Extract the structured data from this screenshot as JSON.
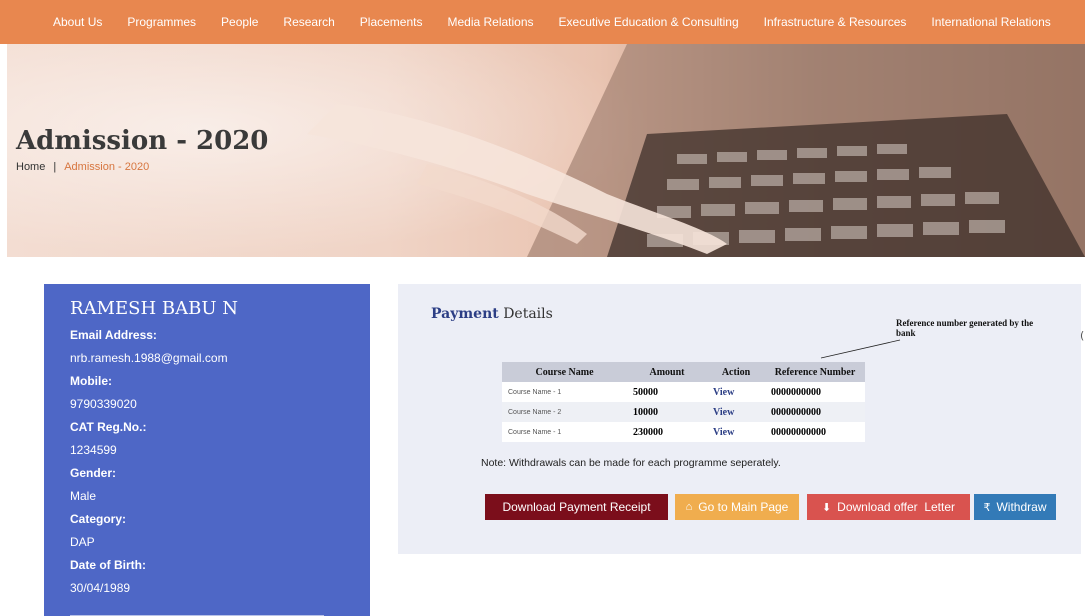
{
  "nav": {
    "items": [
      "About Us",
      "Programmes",
      "People",
      "Research",
      "Placements",
      "Media Relations",
      "Executive Education & Consulting",
      "Infrastructure & Resources",
      "International Relations"
    ]
  },
  "hero": {
    "title": "Admission - 2020",
    "breadcrumb_home": "Home",
    "breadcrumb_sep": "|",
    "breadcrumb_current": "Admission - 2020"
  },
  "profile": {
    "name": "RAMESH BABU N",
    "fields": [
      {
        "label": "Email Address:",
        "value": "nrb.ramesh.1988@gmail.com"
      },
      {
        "label": "Mobile:",
        "value": "9790339020"
      },
      {
        "label": "CAT Reg.No.:",
        "value": "1234599"
      },
      {
        "label": "Gender:",
        "value": "Male"
      },
      {
        "label": "Category:",
        "value": "DAP"
      },
      {
        "label": "Date of Birth:",
        "value": "30/04/1989"
      }
    ]
  },
  "payment": {
    "title_bold": "Payment",
    "title_rest": "Details",
    "annotation": "Reference number generated by the bank",
    "headers": [
      "Course Name",
      "Amount",
      "Action",
      "Reference Number"
    ],
    "rows": [
      {
        "course": "Course Name - 1",
        "amount": "50000",
        "action": "View",
        "ref": "0000000000"
      },
      {
        "course": "Course Name - 2",
        "amount": "10000",
        "action": "View",
        "ref": "0000000000"
      },
      {
        "course": "Course Name - 1",
        "amount": "230000",
        "action": "View",
        "ref": "00000000000"
      }
    ],
    "note": "Note: Withdrawals can be made for each programme seperately.",
    "buttons": {
      "receipt": "Download Payment Receipt",
      "main": "Go to Main Page",
      "offer": "Download offer  Letter",
      "withdraw": "Withdraw"
    }
  },
  "edge_mark": "(",
  "colors": {
    "nav_bg": "#e8874f",
    "profile_bg": "#4e67c6",
    "receipt_btn": "#7b0e1b",
    "main_btn": "#f0ad4e",
    "offer_btn": "#d9534f",
    "withdraw_btn": "#337ab7"
  }
}
